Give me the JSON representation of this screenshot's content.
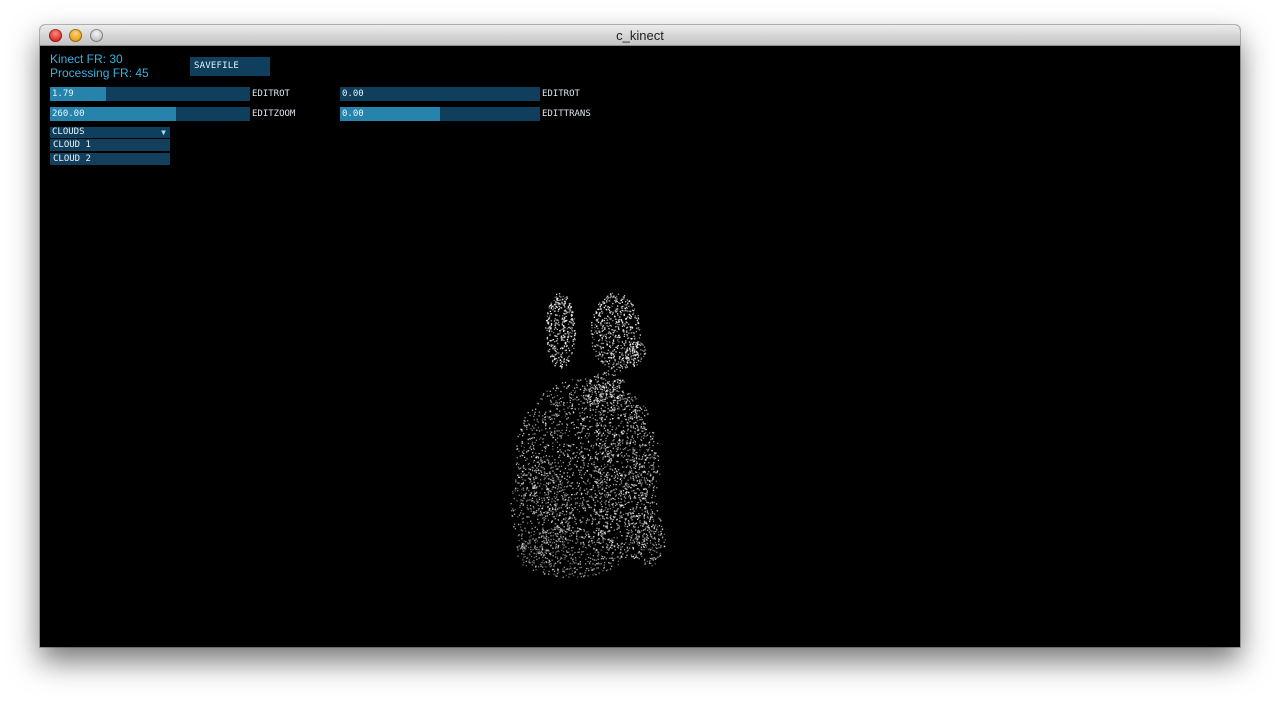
{
  "window": {
    "title": "c_kinect"
  },
  "hud": {
    "kinect_fr": "Kinect FR: 30",
    "processing_fr": "Processing FR: 45",
    "savefile_label": "SAVEFILE"
  },
  "sliders": [
    {
      "value_text": "1.79",
      "label": "EDITROT",
      "fill": 0.28
    },
    {
      "value_text": "0.00",
      "label": "EDITROT",
      "fill": 0.0
    },
    {
      "value_text": "260.00",
      "label": "EDITZOOM",
      "fill": 0.63
    },
    {
      "value_text": "0.00",
      "label": "EDITTRANS",
      "fill": 0.5
    }
  ],
  "clouds": {
    "header": "CLOUDS",
    "items": [
      "CLOUD 1",
      "CLOUD 2"
    ]
  },
  "colors": {
    "accent": "#38b3e0",
    "control_bg": "#0f3f5c",
    "control_fill": "#2684ac",
    "canvas_bg": "#000000",
    "points": "#ffffff"
  }
}
